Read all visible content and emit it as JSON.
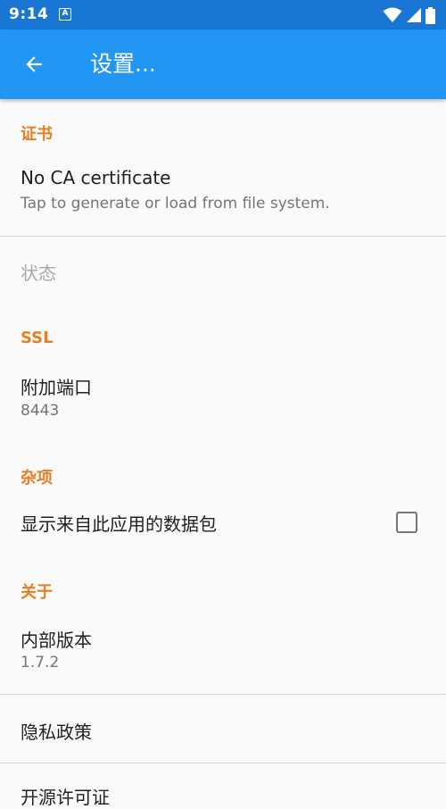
{
  "status_bar": {
    "time": "9:14",
    "notification_icon": "accessibility-a-icon",
    "icons": [
      "wifi-icon",
      "signal-icon",
      "battery-icon"
    ]
  },
  "app_bar": {
    "title": "设置...",
    "back_icon": "arrow-back-icon"
  },
  "sections": {
    "certificate": {
      "header": "证书",
      "ca": {
        "title": "No CA certificate",
        "summary": "Tap to generate or load from file system."
      },
      "status_label": "状态"
    },
    "ssl": {
      "header": "SSL",
      "extra_port": {
        "title": "附加端口",
        "value": "8443"
      }
    },
    "misc": {
      "header": "杂项",
      "show_packets": {
        "title": "显示来自此应用的数据包",
        "checked": false
      }
    },
    "about": {
      "header": "关于",
      "build": {
        "title": "内部版本",
        "value": "1.7.2"
      },
      "privacy": {
        "title": "隐私政策"
      },
      "licenses": {
        "title": "开源许可证"
      }
    }
  },
  "colors": {
    "status_bar": "#1976d2",
    "app_bar": "#2196f3",
    "accent": "#e67e22",
    "background": "#fafafa"
  }
}
